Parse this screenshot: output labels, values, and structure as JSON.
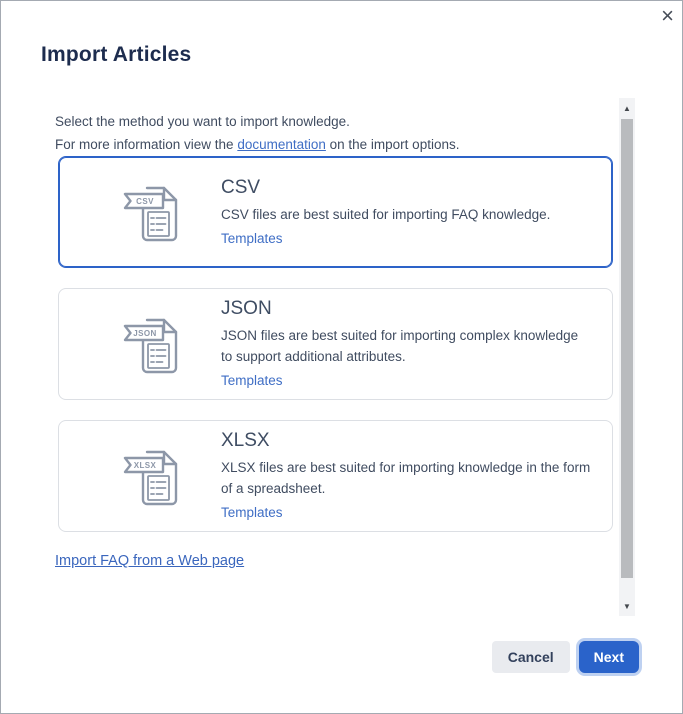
{
  "dialog": {
    "title": "Import Articles"
  },
  "icons": {
    "close": "×",
    "scroll_up": "▲",
    "scroll_down": "▼"
  },
  "intro": {
    "line1": "Select the method you want to import knowledge.",
    "line2_prefix": "For more information view the ",
    "line2_link": "documentation",
    "line2_suffix": " on the import options."
  },
  "methods": [
    {
      "name": "CSV",
      "description_lines": [
        "CSV files are best suited for importing FAQ knowledge."
      ],
      "templates_label": "Templates",
      "selected": true
    },
    {
      "name": "JSON",
      "description_lines": [
        "JSON files are best suited for importing complex knowledge",
        "to support additional attributes."
      ],
      "templates_label": "Templates",
      "selected": false
    },
    {
      "name": "XLSX",
      "description_lines": [
        "XLSX files are best suited for importing knowledge in the form",
        "of a spreadsheet."
      ],
      "templates_label": "Templates",
      "selected": false
    }
  ],
  "web_import_link": "Import FAQ from a Web page",
  "footer": {
    "cancel_label": "Cancel",
    "next_label": "Next"
  },
  "colors": {
    "selected_card_border": "#2d63c8",
    "primary_button": "#2a63ca",
    "link_blue": "#3f6ec5",
    "icon_gray": "#8d97a8"
  }
}
